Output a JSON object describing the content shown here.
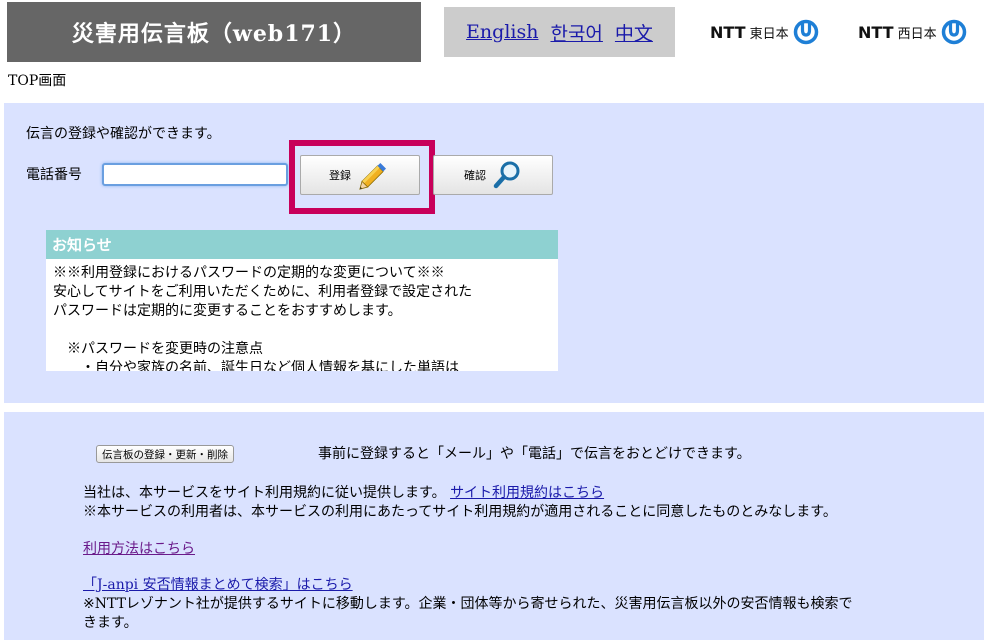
{
  "header": {
    "title": "災害用伝言板（web171）",
    "languages": [
      "English",
      "한국어",
      "中文"
    ],
    "logos": [
      {
        "brand": "NTT",
        "region": "東日本"
      },
      {
        "brand": "NTT",
        "region": "西日本"
      }
    ]
  },
  "page_label": "TOP画面",
  "form": {
    "intro": "伝言の登録や確認ができます。",
    "phone_label": "電話番号",
    "phone_value": "",
    "register_label": "登録",
    "confirm_label": "確認"
  },
  "notice": {
    "header": "お知らせ",
    "lines": [
      "※※利用登録におけるパスワードの定期的な変更について※※",
      "安心してサイトをご利用いただくために、利用者登録で設定された",
      "パスワードは定期的に変更することをおすすめします。",
      "※パスワードを変更時の注意点",
      "・自分や家族の名前、誕生日など個人情報を基にした単語は"
    ]
  },
  "info": {
    "board_button": "伝言板の登録・更新・削除",
    "board_desc": "事前に登録すると「メール」や「電話」で伝言をおとどけできます。",
    "terms_text": "当社は、本サービスをサイト利用規約に従い提供します。",
    "terms_link": "サイト利用規約はこちら",
    "terms_note": "※本サービスの利用者は、本サービスの利用にあたってサイト利用規約が適用されることに同意したものとみなします。",
    "usage_link": "利用方法はこちら",
    "janpi_link": "「J-anpi 安否情報まとめて検索」はこちら",
    "janpi_note_1": "※NTTレゾナント社が提供するサイトに移動します。企業・団体等から寄せられた、災害用伝言板以外の安否情報も検索で",
    "janpi_note_2": "きます。"
  },
  "colors": {
    "title_bg": "#666666",
    "panel_bg": "#dae2ff",
    "notice_header_bg": "#8ed1d1",
    "highlight": "#c8005a",
    "ntt_logo_blue": "#1e7fd6"
  }
}
